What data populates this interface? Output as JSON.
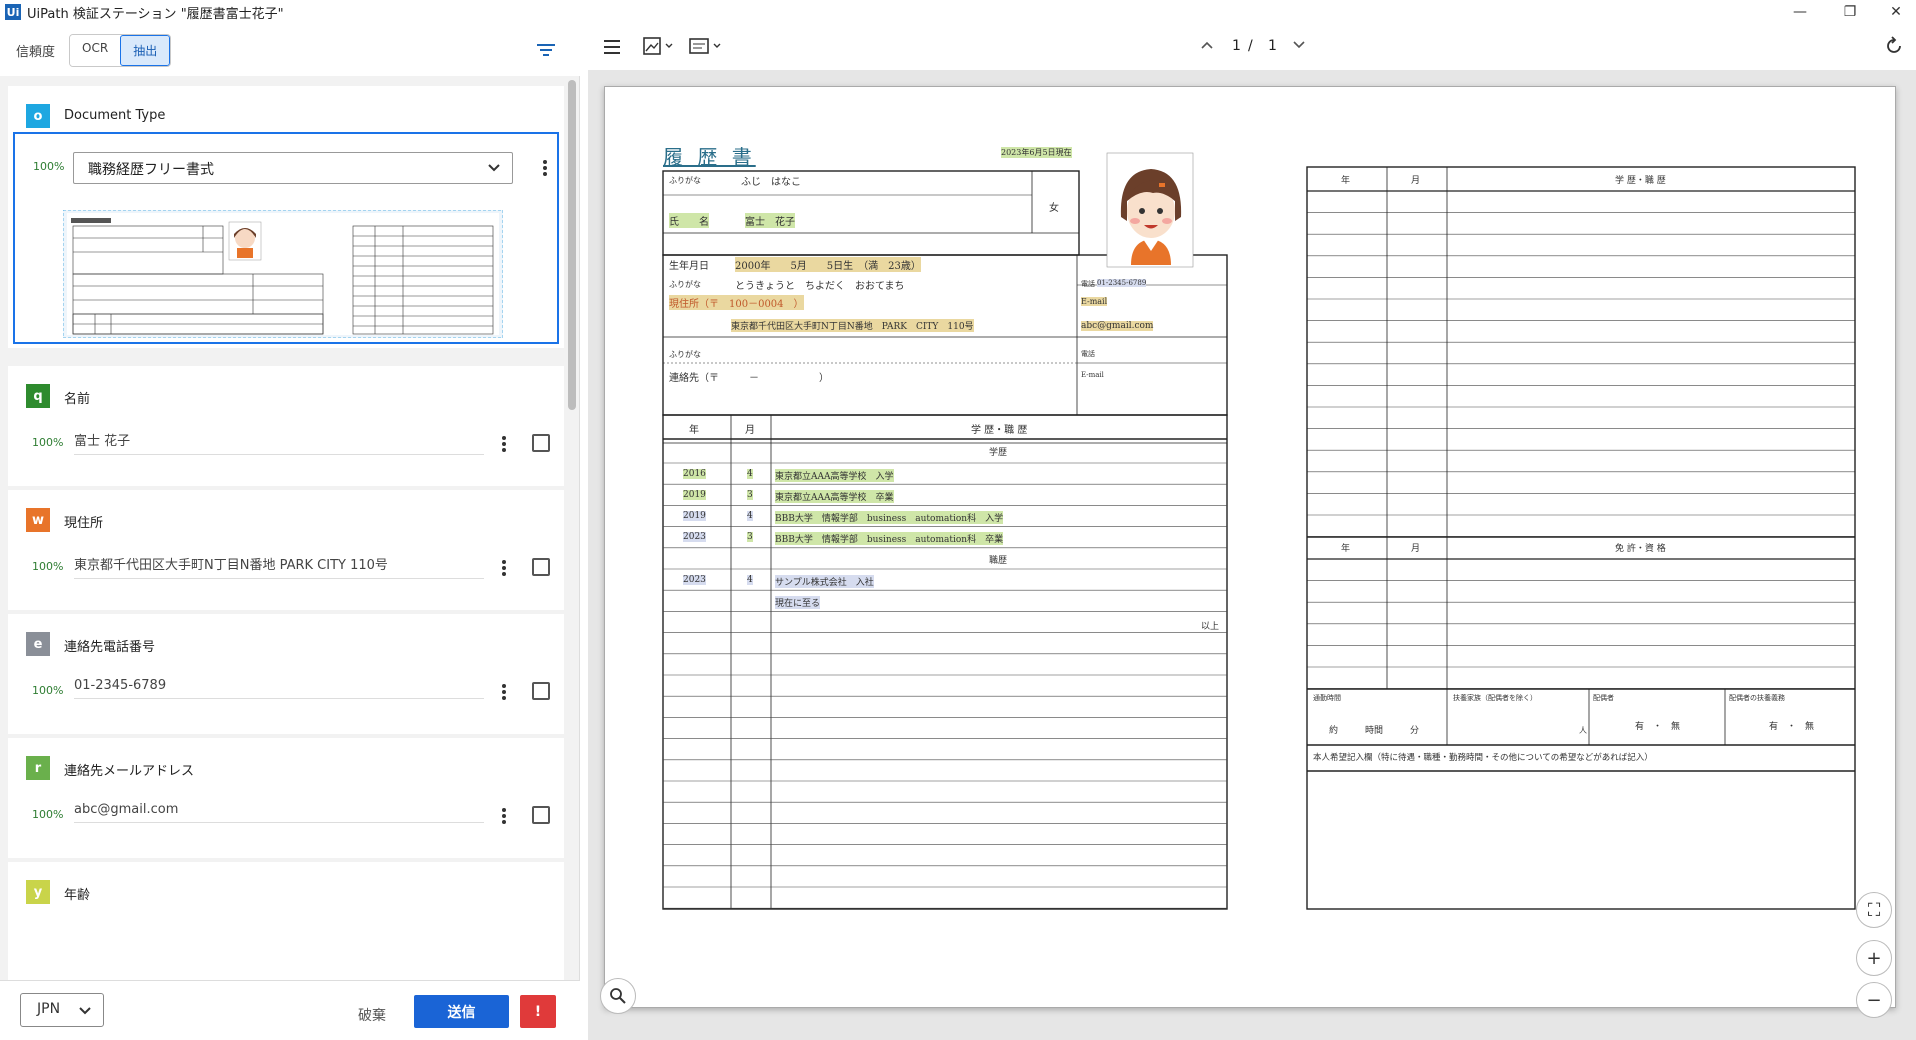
{
  "window": {
    "title": "UiPath 検証ステーション \"履歴書富士花子\"",
    "logo": "Ui"
  },
  "toolbar": {
    "confidence_label": "信頼度",
    "tab_ocr": "OCR",
    "tab_extract": "抽出",
    "filter_icon": "filter-icon"
  },
  "doc_type": {
    "badge": "o",
    "badge_color": "#1ea7e1",
    "title": "Document Type",
    "confidence": "100%",
    "selected": "職務経歴フリー書式"
  },
  "fields": [
    {
      "badge": "q",
      "badge_color": "#2e8b2e",
      "title": "名前",
      "confidence": "100%",
      "value": "富士 花子"
    },
    {
      "badge": "w",
      "badge_color": "#e8742a",
      "title": "現住所",
      "confidence": "100%",
      "value": "東京都千代田区大手町N丁目N番地 PARK CITY 110号"
    },
    {
      "badge": "e",
      "badge_color": "#8a8f98",
      "title": "連絡先電話番号",
      "confidence": "100%",
      "value": "01-2345-6789"
    },
    {
      "badge": "r",
      "badge_color": "#6ab04c",
      "title": "連絡先メールアドレス",
      "confidence": "100%",
      "value": "abc@gmail.com"
    },
    {
      "badge": "y",
      "badge_color": "#c9d44a",
      "title": "年齢"
    }
  ],
  "footer": {
    "language": "JPN",
    "discard": "破棄",
    "submit": "送信",
    "warning": "!"
  },
  "viewer": {
    "page_current": "1",
    "page_separator": "/",
    "page_total": "1"
  },
  "resume": {
    "title": "履 歴 書",
    "date": "2023年6月5日現在",
    "furigana_label": "ふりがな",
    "furigana_name": "ふじ　はなこ",
    "name_label": "氏　　名",
    "name": "富士　花子",
    "gender": "女",
    "birth_label": "生年月日",
    "birth": "2000年　　5月　　5日生　（満　23歳）",
    "address_furigana": "とうきょうと　ちよだく　おおてまち",
    "address_label": "現住所（〒　100－0004　）",
    "address": "東京都千代田区大手町N丁目N番地　PARK　CITY　110号",
    "phone_label": "電話",
    "phone": "01-2345-6789",
    "email_label": "E-mail",
    "email": "abc@gmail.com",
    "contact_label": "連絡先（〒　　　－　　　　　　）",
    "contact_phone_label": "電話",
    "contact_email_label": "E-mail",
    "year_header": "年",
    "month_header": "月",
    "history_header": "学 歴・職 歴",
    "education_label": "学歴",
    "work_label": "職歴",
    "end_label": "以上",
    "education_rows": [
      {
        "year": "2016",
        "month": "4",
        "text": "東京都立AAA高等学校　入学"
      },
      {
        "year": "2019",
        "month": "3",
        "text": "東京都立AAA高等学校　卒業"
      },
      {
        "year": "2019",
        "month": "4",
        "text": "BBB大学　情報学部　business　automation科　入学"
      },
      {
        "year": "2023",
        "month": "3",
        "text": "BBB大学　情報学部　business　automation科　卒業"
      }
    ],
    "work_rows": [
      {
        "year": "2023",
        "month": "4",
        "text": "サンプル株式会社　入社"
      },
      {
        "year": "",
        "month": "",
        "text": "現在に至る"
      }
    ],
    "right_history_header": "学 歴・職 歴",
    "license_header": "免 許・資 格",
    "commute_label": "通勤時間",
    "commute_value": "約　　　時間　　　分",
    "dependents_label": "扶養家族（配偶者を除く）",
    "dependents_unit": "人",
    "spouse_label": "配偶者",
    "spouse_value": "有　・　無",
    "spouse_duty_label": "配偶者の扶養義務",
    "spouse_duty_value": "有　・　無",
    "wishes_label": "本人希望記入欄（特に待遇・職種・勤務時間・その他についての希望などがあれば記入）"
  }
}
